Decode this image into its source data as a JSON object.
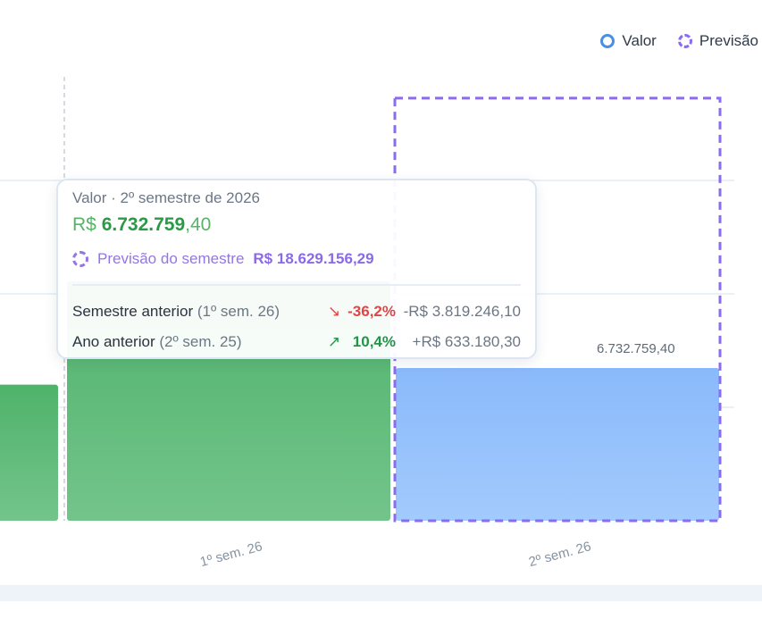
{
  "legend": {
    "value_label": "Valor",
    "forecast_label": "Previsão"
  },
  "chart_data": {
    "type": "bar",
    "categories": [
      "",
      "1º sem. 26",
      "2º sem. 26"
    ],
    "series": [
      {
        "name": "Valor",
        "values": [
          6000000,
          10551000,
          6732759.4
        ]
      },
      {
        "name": "Previsão",
        "values": [
          null,
          null,
          18629156.29
        ]
      }
    ],
    "ylim": [
      0,
      20000000
    ],
    "value_label_last": "6.732.759,40",
    "grid": true,
    "legend_position": "top-right",
    "colors": {
      "past": "#5bb775",
      "current": "#8fbdfb",
      "forecast_border": "#8b6cf0"
    }
  },
  "tooltip": {
    "title": "Valor · 2º semestre de 2026",
    "value_currency": "R$",
    "value_int": "6.732.759",
    "value_dec": ",40",
    "forecast_label": "Previsão do semestre",
    "forecast_value": "R$ 18.629.156,29",
    "rows": [
      {
        "label": "Semestre anterior",
        "period": "(1º sem. 26)",
        "arrow": "↘",
        "pct": "-36,2%",
        "abs": "-R$ 3.819.246,10",
        "trend": "down"
      },
      {
        "label": "Ano anterior",
        "period": "(2º sem. 25)",
        "arrow": "↗",
        "pct": "10,4%",
        "abs": "+R$ 633.180,30",
        "trend": "up"
      }
    ]
  }
}
